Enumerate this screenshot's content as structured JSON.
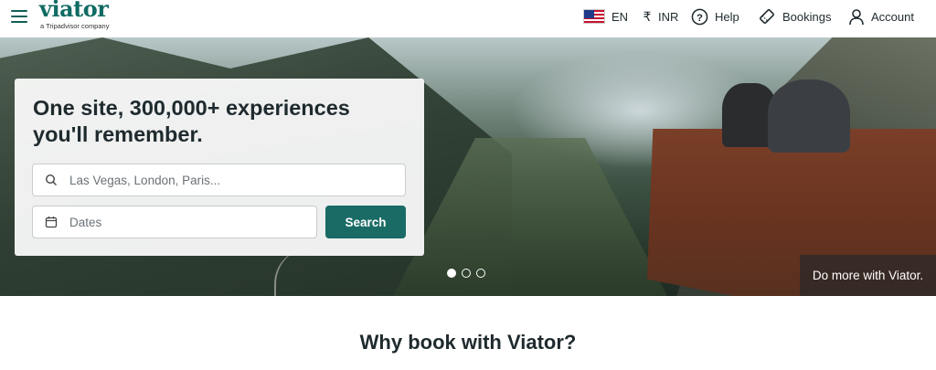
{
  "header": {
    "logo_text": "viator",
    "logo_subtext": "a Tripadvisor company",
    "language": "EN",
    "currency_symbol": "₹",
    "currency": "INR",
    "help_label": "Help",
    "bookings_label": "Bookings",
    "account_label": "Account"
  },
  "hero": {
    "title": "One site, 300,000+ experiences you'll remember.",
    "search": {
      "where_placeholder": "Las Vegas, London, Paris...",
      "dates_placeholder": "Dates",
      "button_label": "Search"
    },
    "carousel": {
      "slides": 3,
      "active_index": 0
    },
    "caption": "Do more with Viator."
  },
  "section": {
    "title": "Why book with Viator?"
  },
  "colors": {
    "brand": "#0f6b63",
    "button": "#1a6b66"
  }
}
